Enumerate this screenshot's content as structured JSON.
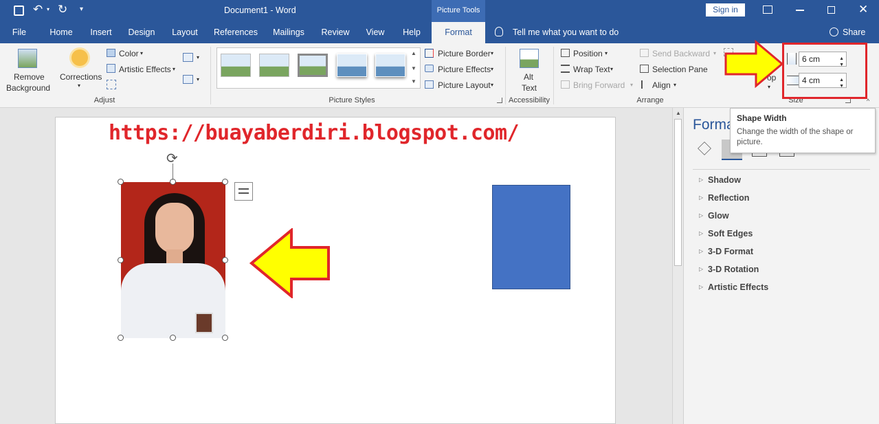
{
  "titlebar": {
    "doc_title": "Document1  -  Word",
    "context_tab": "Picture Tools",
    "sign_in": "Sign in"
  },
  "tabs": [
    "File",
    "Home",
    "Insert",
    "Design",
    "Layout",
    "References",
    "Mailings",
    "Review",
    "View",
    "Help",
    "Format"
  ],
  "tell_me": "Tell me what you want to do",
  "share": "Share",
  "ribbon": {
    "remove_background": [
      "Remove",
      "Background"
    ],
    "corrections": "Corrections",
    "color": "Color",
    "artistic_effects": "Artistic Effects",
    "group_adjust": "Adjust",
    "picture_border": "Picture Border",
    "picture_effects": "Picture Effects",
    "picture_layout": "Picture Layout",
    "group_picture_styles": "Picture Styles",
    "alt_text": [
      "Alt",
      "Text"
    ],
    "group_accessibility": "Accessibility",
    "position": "Position",
    "wrap_text": "Wrap Text",
    "bring_forward": "Bring Forward",
    "send_backward": "Send Backward",
    "selection_pane": "Selection Pane",
    "align": "Align",
    "group_arrange": "Arrange",
    "crop": "op",
    "height_value": "6 cm",
    "width_value": "4 cm",
    "group_size": "Size"
  },
  "tooltip": {
    "title": "Shape Width",
    "body": "Change the width of the shape or picture."
  },
  "document": {
    "url_text": "https://buayaberdiri.blogspot.com/"
  },
  "pane": {
    "title": "Forma",
    "items": [
      "Shadow",
      "Reflection",
      "Glow",
      "Soft Edges",
      "3-D Format",
      "3-D Rotation",
      "Artistic Effects"
    ]
  },
  "colors": {
    "word_blue": "#2b579a",
    "shape_blue": "#4472c4",
    "annotation_red": "#e0262b",
    "arrow_yellow": "#ffff00",
    "photo_bg": "#b3261a"
  }
}
